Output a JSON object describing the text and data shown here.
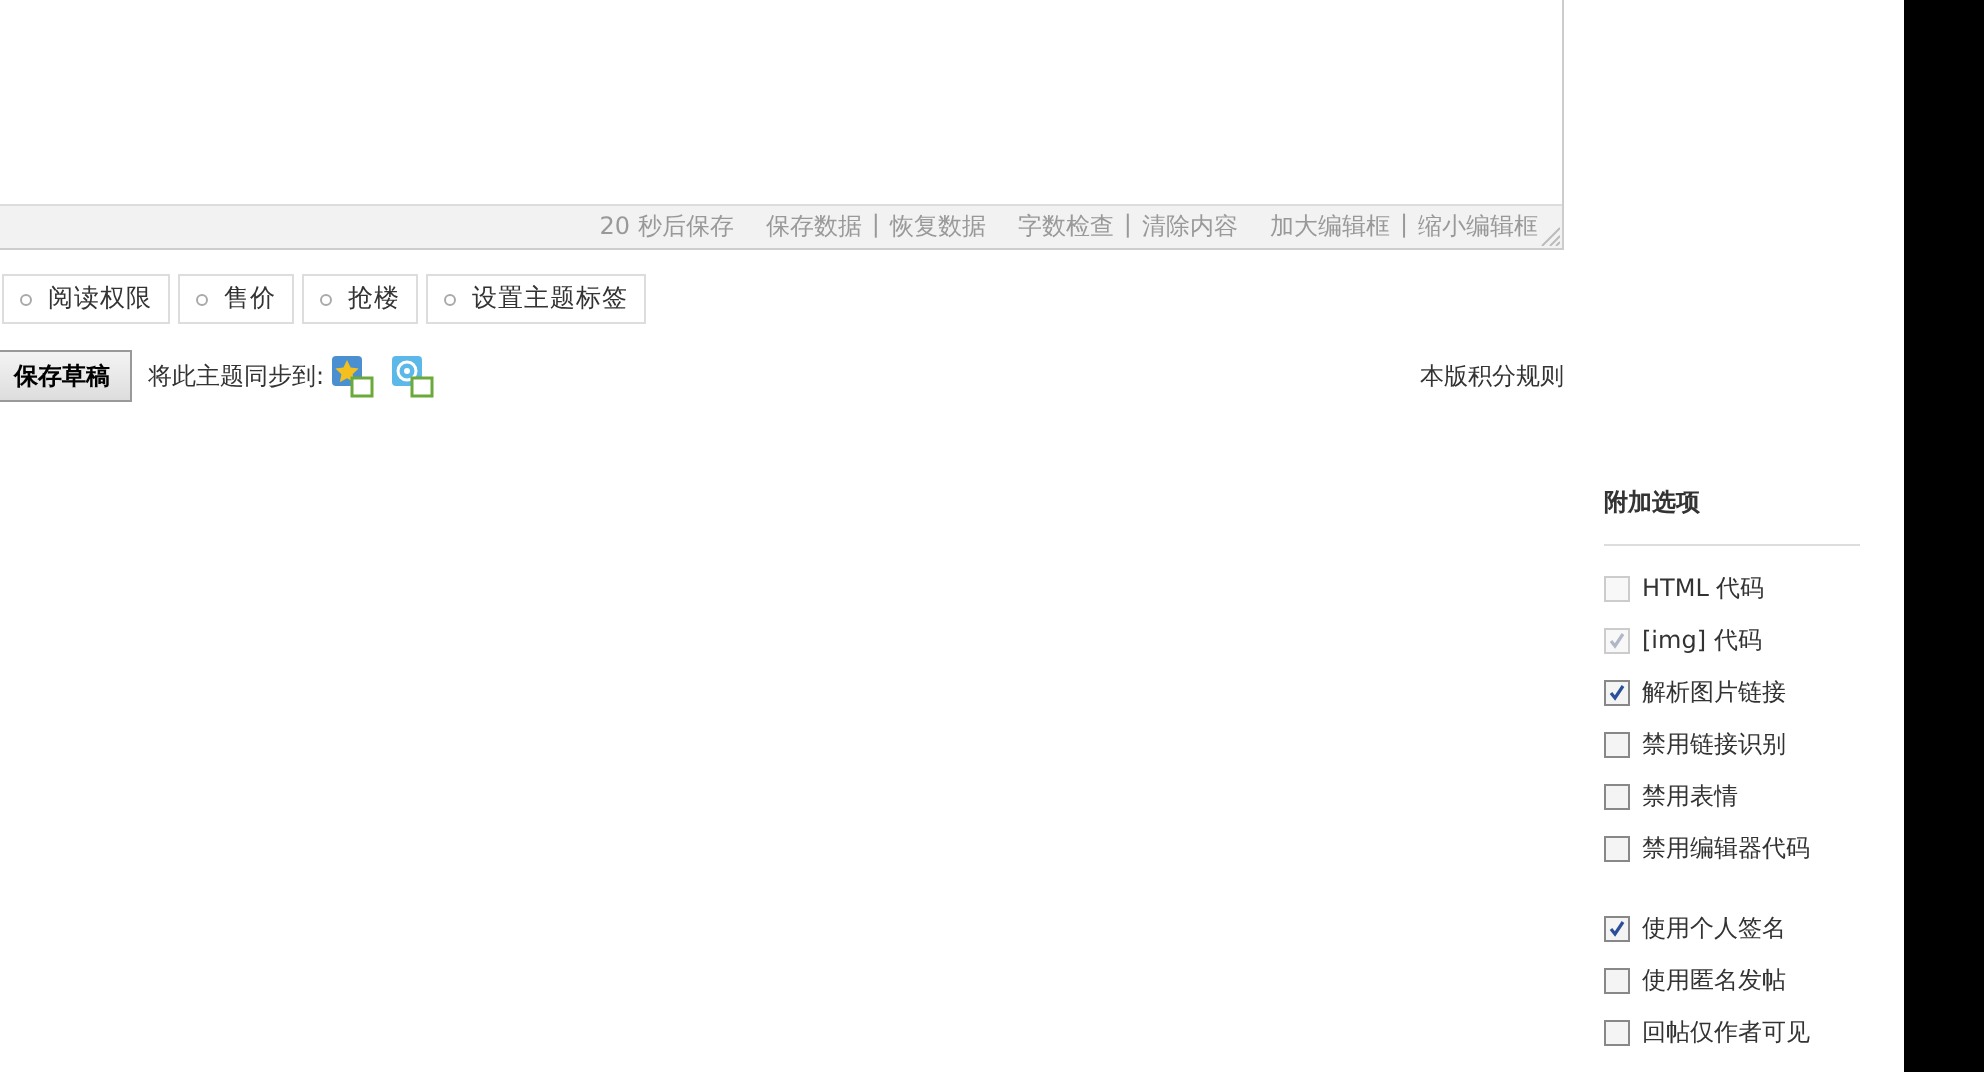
{
  "editor": {
    "autosave": "20 秒后保存",
    "separator": "|",
    "link_groups": [
      [
        "保存数据",
        "恢复数据"
      ],
      [
        "字数检查",
        "清除内容"
      ],
      [
        "加大编辑框",
        "缩小编辑框"
      ]
    ]
  },
  "extra_buttons": [
    "阅读权限",
    "售价",
    "抢楼",
    "设置主题标签"
  ],
  "save_draft": "保存草稿",
  "sync_label": "将此主题同步到:",
  "rules_link": "本版积分规则",
  "options": {
    "title": "附加选项",
    "groups": [
      [
        {
          "label": "HTML 代码",
          "checked": false,
          "disabled": true
        },
        {
          "label": "[img] 代码",
          "checked": true,
          "disabled": true
        },
        {
          "label": "解析图片链接",
          "checked": true,
          "disabled": false
        },
        {
          "label": "禁用链接识别",
          "checked": false,
          "disabled": false
        },
        {
          "label": "禁用表情",
          "checked": false,
          "disabled": false
        },
        {
          "label": "禁用编辑器代码",
          "checked": false,
          "disabled": false
        }
      ],
      [
        {
          "label": "使用个人签名",
          "checked": true,
          "disabled": false
        },
        {
          "label": "使用匿名发帖",
          "checked": false,
          "disabled": false
        },
        {
          "label": "回帖仅作者可见",
          "checked": false,
          "disabled": false
        }
      ]
    ]
  }
}
